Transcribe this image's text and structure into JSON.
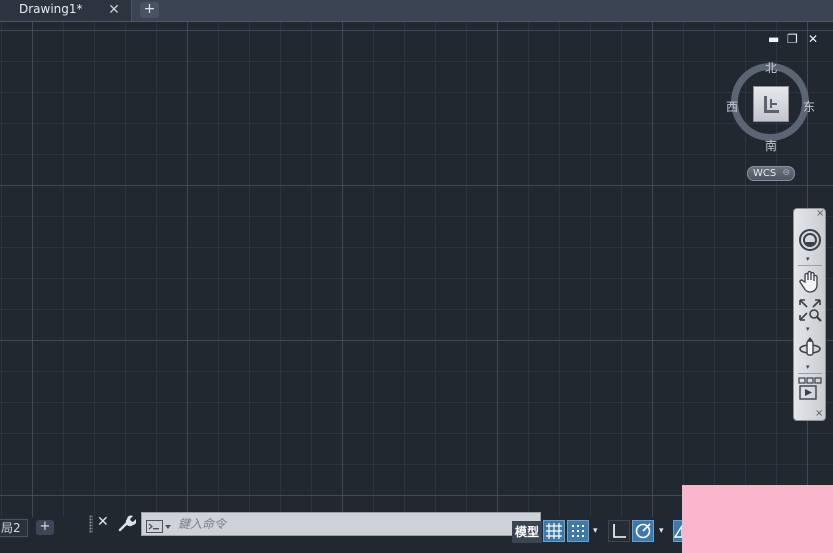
{
  "tabs": {
    "document_tab_label": "Drawing1*",
    "close_glyph": "✕",
    "new_tab_glyph": "+"
  },
  "viewport_controls": {
    "minimize": "▬",
    "restore": "❐",
    "close": "✕"
  },
  "viewcube": {
    "north": "北",
    "south": "南",
    "east": "东",
    "west": "西",
    "cube_face": "上",
    "wcs_label": "WCS",
    "wcs_arrow": "⊖"
  },
  "navbar": {
    "close_glyph": "×",
    "items": [
      "steeringwheel-icon",
      "pan-icon",
      "zoom-extents-icon",
      "orbit-icon",
      "showmotion-icon"
    ],
    "drop_glyph": "▾"
  },
  "layout_tabs": {
    "active_label": "局2",
    "add_glyph": "+"
  },
  "command_line": {
    "close_glyph": "✕",
    "placeholder": "鍵入命令"
  },
  "status_bar": {
    "model_label": "模型",
    "drop_glyph": "▾",
    "buttons": [
      "grid-icon",
      "snap-icon",
      "ortho-icon",
      "polar-icon",
      "isodraft-icon"
    ]
  },
  "colors": {
    "background": "#212830",
    "grid_major": "#4e5c6e",
    "status_active": "#3f79a9",
    "overlay_pink": "#f9b6cd"
  }
}
